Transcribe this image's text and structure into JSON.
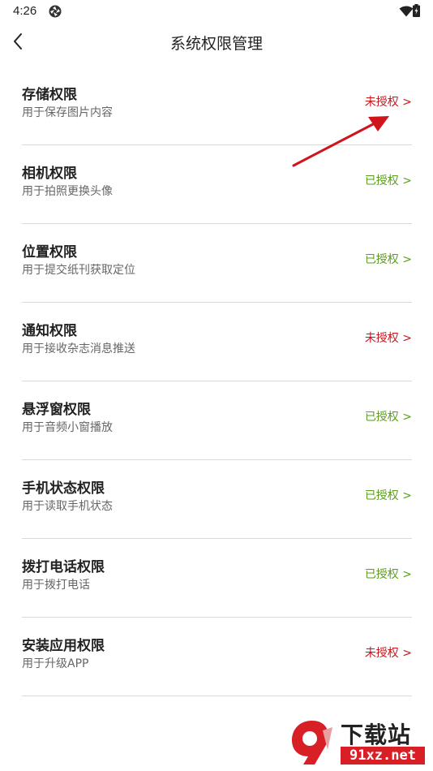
{
  "status_bar": {
    "time": "4:26",
    "app_icon": "aperture-icon",
    "wifi_icon": "wifi-icon",
    "battery_icon": "battery-charging-icon"
  },
  "header": {
    "back_icon": "chevron-left-icon",
    "title": "系统权限管理"
  },
  "colors": {
    "unauthorized": "#c8161d",
    "authorized": "#5a9e1b",
    "annotation": "#d0141b"
  },
  "permissions": [
    {
      "name": "存储权限",
      "desc": "用于保存图片内容",
      "status": "未授权 >",
      "authorized": false
    },
    {
      "name": "相机权限",
      "desc": "用于拍照更换头像",
      "status": "已授权 >",
      "authorized": true
    },
    {
      "name": "位置权限",
      "desc": "用于提交纸刊获取定位",
      "status": "已授权 >",
      "authorized": true
    },
    {
      "name": "通知权限",
      "desc": "用于接收杂志消息推送",
      "status": "未授权 >",
      "authorized": false
    },
    {
      "name": "悬浮窗权限",
      "desc": "用于音频小窗播放",
      "status": "已授权 >",
      "authorized": true
    },
    {
      "name": "手机状态权限",
      "desc": "用于读取手机状态",
      "status": "已授权 >",
      "authorized": true
    },
    {
      "name": "拨打电话权限",
      "desc": "用于拨打电话",
      "status": "已授权 >",
      "authorized": true
    },
    {
      "name": "安装应用权限",
      "desc": "用于升级APP",
      "status": "未授权 >",
      "authorized": false
    }
  ],
  "watermark": {
    "top": "下载站",
    "bottom": "91xz.net"
  }
}
